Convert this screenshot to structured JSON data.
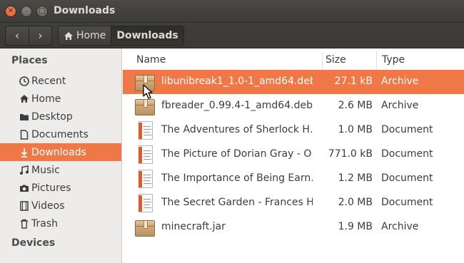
{
  "window": {
    "title": "Downloads",
    "close_glyph": "✕",
    "min_glyph": "–",
    "max_glyph": "□"
  },
  "toolbar": {
    "back_glyph": "‹",
    "forward_glyph": "›",
    "crumbs": [
      {
        "label": "Home",
        "icon": "home-icon"
      },
      {
        "label": "Downloads"
      }
    ]
  },
  "sidebar": {
    "places_heading": "Places",
    "items": [
      {
        "label": "Recent",
        "icon": "clock-icon"
      },
      {
        "label": "Home",
        "icon": "home-icon"
      },
      {
        "label": "Desktop",
        "icon": "folder-icon"
      },
      {
        "label": "Documents",
        "icon": "document-icon"
      },
      {
        "label": "Downloads",
        "icon": "download-icon",
        "active": true
      },
      {
        "label": "Music",
        "icon": "music-icon"
      },
      {
        "label": "Pictures",
        "icon": "camera-icon"
      },
      {
        "label": "Videos",
        "icon": "film-icon"
      },
      {
        "label": "Trash",
        "icon": "trash-icon"
      }
    ],
    "devices_heading": "Devices"
  },
  "list": {
    "columns": {
      "name": "Name",
      "size": "Size",
      "type": "Type"
    },
    "rows": [
      {
        "name": "libunibreak1_1.0-1_amd64.deb",
        "size": "27.1 kB",
        "type": "Archive",
        "icon": "archive-icon",
        "selected": true
      },
      {
        "name": "fbreader_0.99.4-1_amd64.deb",
        "size": "2.6 MB",
        "type": "Archive",
        "icon": "archive-icon"
      },
      {
        "name": "The Adventures of Sherlock H…",
        "size": "1.0 MB",
        "type": "Document",
        "icon": "document-file-icon"
      },
      {
        "name": "The Picture of Dorian Gray - O…",
        "size": "771.0 kB",
        "type": "Document",
        "icon": "document-file-icon"
      },
      {
        "name": "The Importance of Being Earn…",
        "size": "1.2 MB",
        "type": "Document",
        "icon": "document-file-icon"
      },
      {
        "name": "The Secret Garden - Frances H…",
        "size": "2.0 MB",
        "type": "Document",
        "icon": "document-file-icon"
      },
      {
        "name": "minecraft.jar",
        "size": "1.9 MB",
        "type": "Archive",
        "icon": "archive-icon"
      }
    ]
  },
  "colors": {
    "accent": "#f07746",
    "titlebar": "#3c3b37",
    "sidebar": "#edeceb"
  }
}
